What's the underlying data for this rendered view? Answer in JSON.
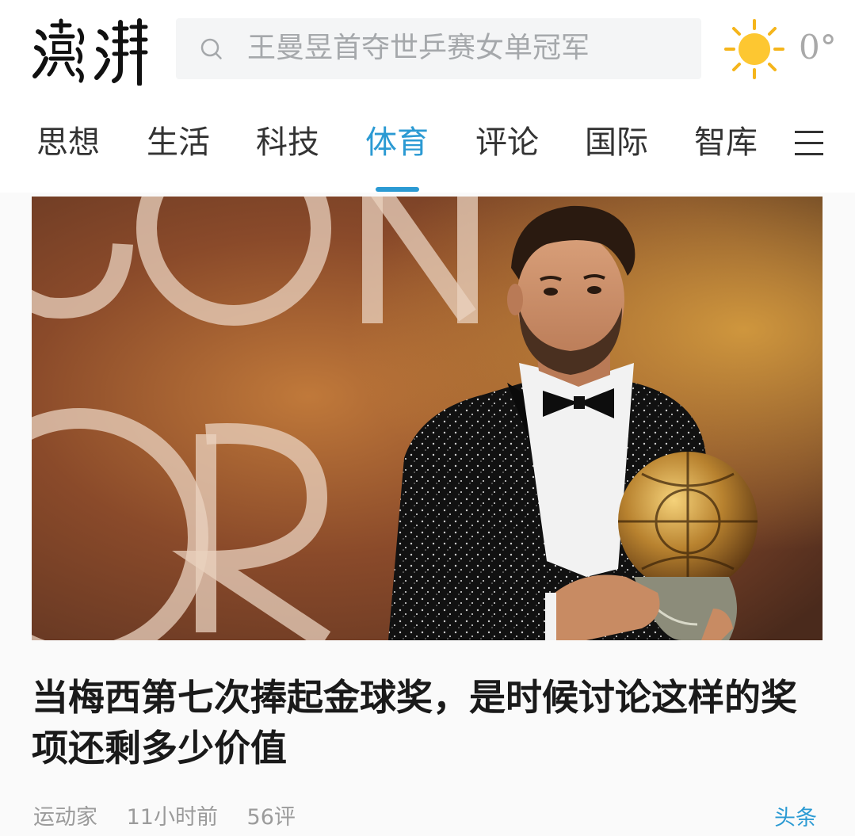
{
  "header": {
    "logo_text": "澎湃",
    "search_placeholder": "王曼昱首夺世乒赛女单冠军",
    "weather_icon": "sun-icon",
    "temperature": "0°"
  },
  "nav": {
    "tabs": [
      {
        "label": "思想",
        "active": false
      },
      {
        "label": "生活",
        "active": false
      },
      {
        "label": "科技",
        "active": false
      },
      {
        "label": "体育",
        "active": true
      },
      {
        "label": "评论",
        "active": false
      },
      {
        "label": "国际",
        "active": false
      },
      {
        "label": "智库",
        "active": false
      }
    ],
    "menu_icon": "hamburger-menu-icon",
    "accent_color": "#2b9ad3"
  },
  "article": {
    "image_alt": "",
    "headline": "当梅西第七次捧起金球奖，是时候讨论这样的奖项还剩多少价值",
    "source": "运动家",
    "time": "11小时前",
    "comments": "56评",
    "tag": "头条"
  }
}
